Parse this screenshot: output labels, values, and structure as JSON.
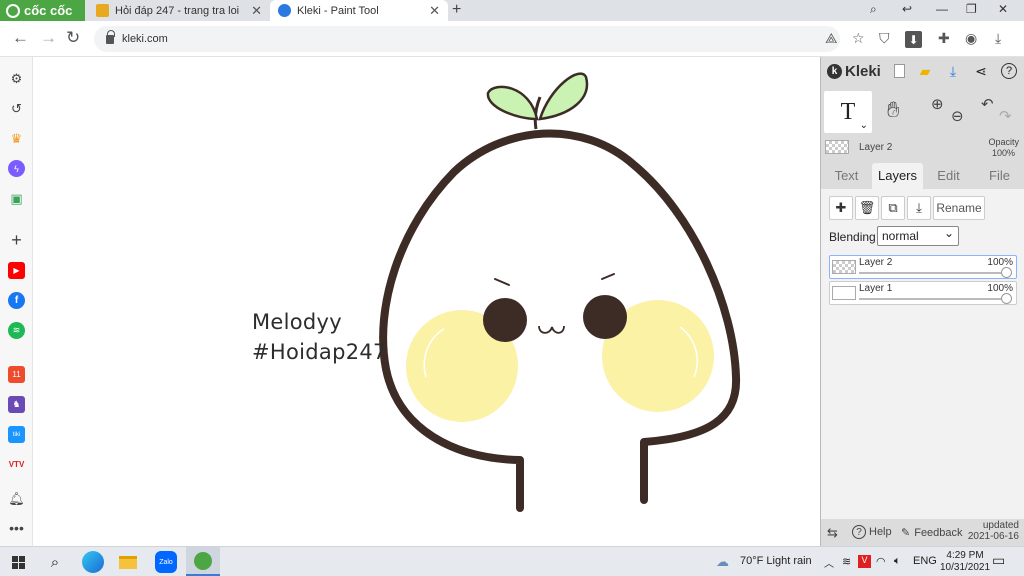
{
  "browser": {
    "brand": "cốc cốc",
    "tabs": [
      {
        "title": "Hỏi đáp 247 - trang tra loi",
        "active": false,
        "favicon_color": "#e8a820"
      },
      {
        "title": "Kleki - Paint Tool",
        "active": true,
        "favicon_color": "#2a7ae2"
      }
    ],
    "url": "kleki.com"
  },
  "sidebar": {
    "items": [
      "settings-icon",
      "history-icon",
      "crown-icon",
      "messenger-icon",
      "game-icon",
      "add-icon",
      "youtube-icon",
      "facebook-icon",
      "spotify-icon",
      "shopee-icon",
      "app-icon",
      "tiki-icon",
      "vtv-icon",
      "bell-icon",
      "more-icon"
    ]
  },
  "canvas": {
    "signature_line1": "Melodyy",
    "signature_line2": "#Hoidap247",
    "colors": {
      "outline": "#3d2b26",
      "leaf": "#c9f2b3",
      "cheek": "#fbf2a6"
    }
  },
  "kleki": {
    "logo": "Kleki",
    "current_layer": "Layer 2",
    "opacity_label": "Opacity",
    "opacity_value": "100%",
    "tabs": [
      "Text",
      "Layers",
      "Edit",
      "File"
    ],
    "active_tab": "Layers",
    "rename_label": "Rename",
    "blending_label": "Blending",
    "blending_value": "normal",
    "layers": [
      {
        "name": "Layer 2",
        "opacity": "100%",
        "selected": true
      },
      {
        "name": "Layer 1",
        "opacity": "100%",
        "selected": false
      }
    ],
    "footer": {
      "help": "Help",
      "feedback": "Feedback",
      "updated": "updated",
      "date": "2021-06-16"
    }
  },
  "taskbar": {
    "weather": "70°F  Light rain",
    "lang": "ENG",
    "time": "4:29 PM",
    "date": "10/31/2021"
  }
}
